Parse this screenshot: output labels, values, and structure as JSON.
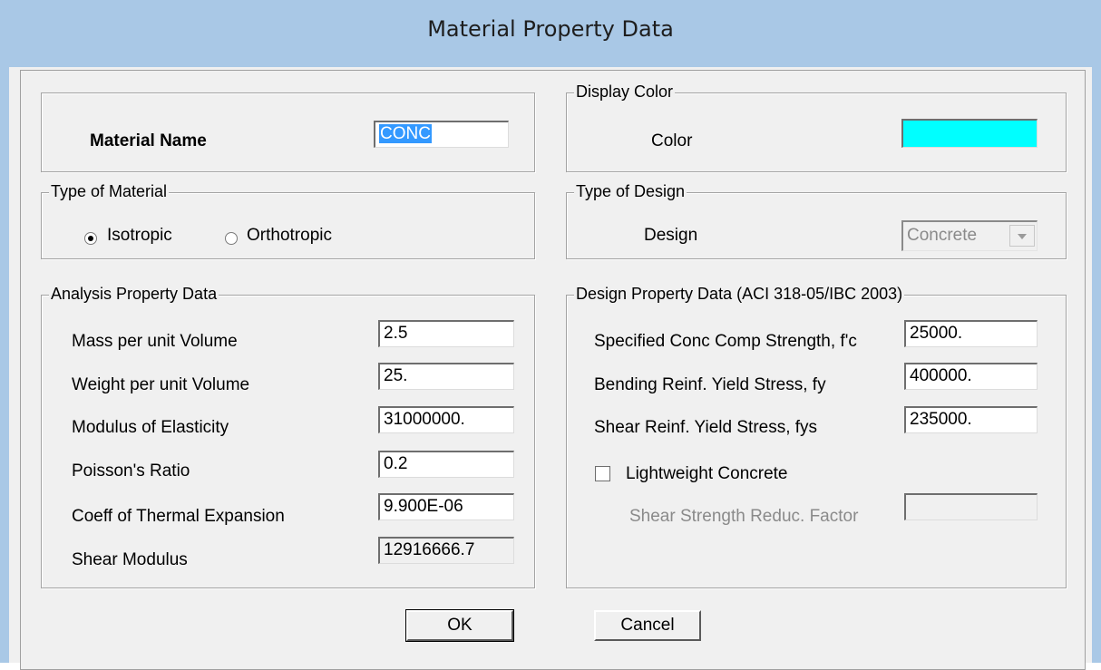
{
  "window": {
    "title": "Material Property Data"
  },
  "material_name": {
    "label": "Material Name",
    "value": "CONC"
  },
  "display_color": {
    "group_title": "Display Color",
    "label": "Color",
    "swatch_color": "#00ffff"
  },
  "type_of_material": {
    "group_title": "Type of Material",
    "options": [
      {
        "label": "Isotropic",
        "checked": true
      },
      {
        "label": "Orthotropic",
        "checked": false
      }
    ]
  },
  "type_of_design": {
    "group_title": "Type of Design",
    "label": "Design",
    "selected": "Concrete"
  },
  "analysis_property": {
    "group_title": "Analysis Property Data",
    "rows": [
      {
        "label": "Mass per unit Volume",
        "value": "2.5"
      },
      {
        "label": "Weight per unit Volume",
        "value": "25."
      },
      {
        "label": "Modulus of Elasticity",
        "value": "31000000."
      },
      {
        "label": "Poisson's Ratio",
        "value": "0.2"
      },
      {
        "label": "Coeff of Thermal Expansion",
        "value": "9.900E-06"
      },
      {
        "label": "Shear Modulus",
        "value": "12916666.7"
      }
    ]
  },
  "design_property": {
    "group_title": "Design Property Data (ACI 318-05/IBC 2003)",
    "rows": [
      {
        "label": "Specified Conc Comp Strength, f'c",
        "value": "25000."
      },
      {
        "label": "Bending Reinf. Yield Stress, fy",
        "value": "400000."
      },
      {
        "label": "Shear Reinf. Yield Stress, fys",
        "value": "235000."
      }
    ],
    "lightweight_label": "Lightweight Concrete",
    "shear_reduc_label": "Shear Strength Reduc. Factor",
    "shear_reduc_value": ""
  },
  "buttons": {
    "ok": "OK",
    "cancel": "Cancel"
  }
}
